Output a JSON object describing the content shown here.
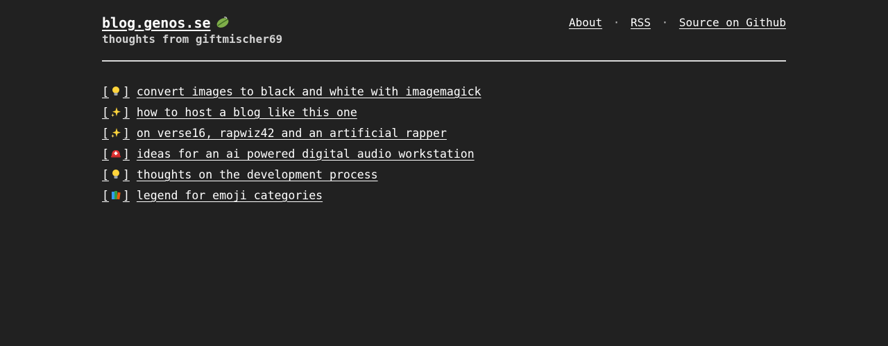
{
  "header": {
    "site_title": "blog.genos.se",
    "logo_icon": "leaf-icon",
    "subtitle": "thoughts from giftmischer69",
    "nav": [
      {
        "label": "About"
      },
      {
        "label": "RSS"
      },
      {
        "label": "Source on Github"
      }
    ],
    "separator": "·"
  },
  "posts": [
    {
      "icon": "lightbulb-icon",
      "title": "convert images to black and white with imagemagick"
    },
    {
      "icon": "sparkles-icon",
      "title": "how to host a blog like this one"
    },
    {
      "icon": "sparkles-icon",
      "title": "on verse16, rapwiz42 and an artificial rapper"
    },
    {
      "icon": "rescue-helmet-icon",
      "title": "ideas for an ai powered digital audio workstation"
    },
    {
      "icon": "lightbulb-icon",
      "title": "thoughts on the development process"
    },
    {
      "icon": "books-icon",
      "title": "legend for emoji categories"
    }
  ],
  "colors": {
    "background": "#212121",
    "text": "#ffffff",
    "rule": "#d9d9d9"
  }
}
